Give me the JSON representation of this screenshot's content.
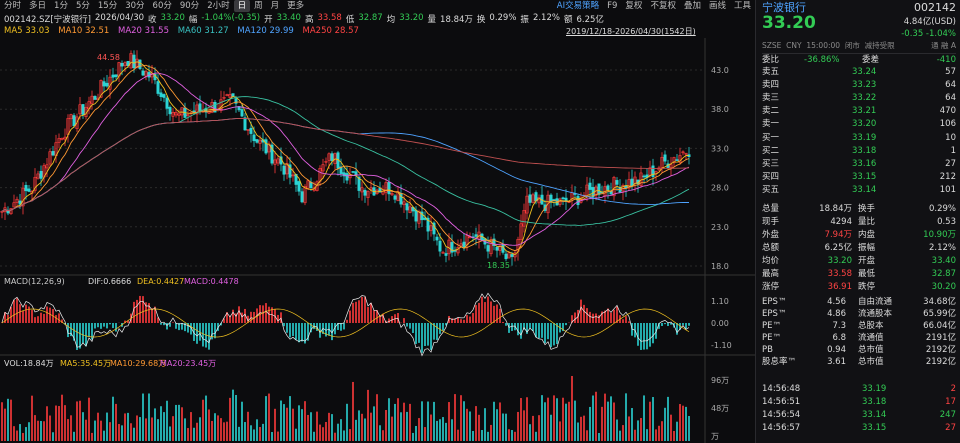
{
  "toolbar": {
    "items": [
      "分时",
      "多日",
      "1分",
      "5分",
      "15分",
      "30分",
      "60分",
      "90分",
      "2小时",
      "日",
      "周",
      "月",
      "更多"
    ],
    "active": "日",
    "right": [
      "AI交易策略",
      "F9",
      "复权",
      "不复权",
      "叠加",
      "画线",
      "工具"
    ]
  },
  "info": {
    "code": "002142.SZ[宁波银行]",
    "date": "2026/04/30",
    "close_label": "收",
    "close": "33.20",
    "chg_label": "幅",
    "chg": "-1.04%(-0.35)",
    "open_label": "开",
    "open": "33.40",
    "high_label": "高",
    "high": "33.58",
    "low_label": "低",
    "low": "32.87",
    "avg_label": "均",
    "avg": "33.20",
    "vol_label": "量",
    "vol": "18.84万",
    "turn_label": "换",
    "turn": "0.29%",
    "amp_label": "振",
    "amp": "2.12%",
    "amt_label": "额",
    "amt": "6.25亿"
  },
  "ma": {
    "ma5": "MA5 33.03",
    "ma10": "MA10 32.51",
    "ma20": "MA20 31.55",
    "ma60": "MA60 31.27",
    "ma120": "MA120 29.99",
    "ma250": "MA250 28.57"
  },
  "daterange": "2019/12/18-2026/04/30(1542日)",
  "price_axis": [
    "43.0",
    "38.0",
    "33.0",
    "28.0",
    "23.0",
    "18.0"
  ],
  "annotations": {
    "high": "44.58",
    "low": "18.35"
  },
  "macd": {
    "title": "MACD(12,26,9)",
    "dif": "DIF:0.6666",
    "dea": "DEA:0.4427",
    "macd": "MACD:0.4478",
    "axis": [
      "1.10",
      "0.00",
      "-1.10"
    ]
  },
  "vol": {
    "title": "VOL:18.84万",
    "ma5": "MA5:35.45万",
    "ma10": "MA10:29.68万",
    "ma20": "MA20:23.45万",
    "axis": [
      "96万",
      "48万",
      "万"
    ]
  },
  "chart_data": {
    "type": "line",
    "series": [
      {
        "name": "K",
        "points_approx": [
          [
            0,
            25
          ],
          [
            30,
            28
          ],
          [
            60,
            35
          ],
          [
            95,
            40
          ],
          [
            125,
            44.58
          ],
          [
            150,
            42
          ],
          [
            175,
            37
          ],
          [
            200,
            38
          ],
          [
            230,
            39
          ],
          [
            255,
            34
          ],
          [
            280,
            31
          ],
          [
            300,
            27
          ],
          [
            330,
            32
          ],
          [
            360,
            28
          ],
          [
            390,
            28
          ],
          [
            420,
            24
          ],
          [
            440,
            20
          ],
          [
            470,
            22
          ],
          [
            495,
            20
          ],
          [
            510,
            18.35
          ],
          [
            525,
            26
          ],
          [
            560,
            26
          ],
          [
            600,
            28
          ],
          [
            640,
            29
          ],
          [
            660,
            31
          ],
          [
            690,
            33.2
          ]
        ]
      }
    ],
    "ylim": [
      16,
      46
    ]
  },
  "panel": {
    "name": "宁波银行",
    "code": "002142",
    "price": "33.20",
    "sub": "4.84亿(USD)",
    "chg": "-0.35  -1.04%",
    "meta": [
      "SZSE",
      "CNY",
      "15:00:00",
      "闭市",
      "减持受限"
    ],
    "icons": "通 融 A",
    "weibi_label": "委比",
    "weibi": "-36.86%",
    "weicha_label": "委差",
    "weicha": "-410",
    "asks": [
      {
        "l": "卖五",
        "p": "33.24",
        "v": "57"
      },
      {
        "l": "卖四",
        "p": "33.23",
        "v": "64"
      },
      {
        "l": "卖三",
        "p": "33.22",
        "v": "64"
      },
      {
        "l": "卖二",
        "p": "33.21",
        "v": "470"
      },
      {
        "l": "卖一",
        "p": "33.20",
        "v": "106"
      }
    ],
    "bids": [
      {
        "l": "买一",
        "p": "33.19",
        "v": "10"
      },
      {
        "l": "买二",
        "p": "33.18",
        "v": "1"
      },
      {
        "l": "买三",
        "p": "33.16",
        "v": "27"
      },
      {
        "l": "买四",
        "p": "33.15",
        "v": "212"
      },
      {
        "l": "买五",
        "p": "33.14",
        "v": "101"
      }
    ],
    "stats": [
      [
        "总量",
        "18.84万",
        "换手",
        "0.29%"
      ],
      [
        "现手",
        "4294",
        "量比",
        "0.53"
      ],
      [
        "外盘",
        "7.94万",
        "内盘",
        "10.90万"
      ],
      [
        "总额",
        "6.25亿",
        "振幅",
        "2.12%"
      ],
      [
        "均价",
        "33.20",
        "开盘",
        "33.40"
      ],
      [
        "最高",
        "33.58",
        "最低",
        "32.87"
      ],
      [
        "涨停",
        "36.91",
        "跌停",
        "30.20"
      ]
    ],
    "fund": [
      [
        "EPS™",
        "4.56",
        "自由流通",
        "34.68亿"
      ],
      [
        "EPS™",
        "4.86",
        "流通股本",
        "65.99亿"
      ],
      [
        "PE™",
        "7.3",
        "总股本",
        "66.04亿"
      ],
      [
        "PE™",
        "6.8",
        "流通值",
        "2191亿"
      ],
      [
        "PB",
        "0.94",
        "总市值",
        "2192亿"
      ],
      [
        "股息率™",
        "3.61",
        "总市值",
        "2192亿"
      ]
    ],
    "ticks": [
      [
        "14:56:48",
        "33.19",
        "2"
      ],
      [
        "14:56:51",
        "33.18",
        "17"
      ],
      [
        "14:56:54",
        "33.14",
        "247"
      ],
      [
        "14:56:57",
        "33.15",
        "27"
      ]
    ]
  }
}
